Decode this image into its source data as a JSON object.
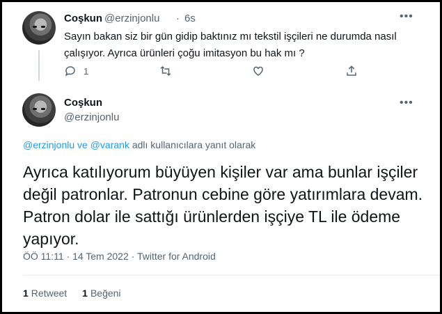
{
  "parent_tweet": {
    "name": "Coşkun",
    "handle": "@erzinjonlu",
    "separator": "·",
    "time": "6s",
    "text": "Sayın bakan siz bir gün gidip baktınız mı tekstil işçileri ne durumda nasıl çalışıyor. Ayrıca ürünleri çoğu imitasyon bu hak mı ?",
    "reply_count": "1",
    "icons": [
      "reply-icon",
      "retweet-icon",
      "like-icon",
      "share-icon",
      "more-icon"
    ]
  },
  "main_tweet": {
    "name": "Coşkun",
    "handle": "@erzinjonlu",
    "reply_to": {
      "mention1": "@erzinjonlu",
      "connector": " ve ",
      "mention2": "@varank",
      "suffix": " adlı kullanıcılara yanıt olarak"
    },
    "text": "Ayrıca katılıyorum büyüyen kişiler var ama bunlar işçiler değil patronlar. Patronun cebine göre yatırımlara devam. Patron dolar ile sattığı ürünlerden işçiye TL ile ödeme yapıyor.",
    "timestamp": "ÖÖ 11:11 · 14 Tem 2022 · Twitter for Android",
    "retweets": {
      "count": "1",
      "label": "Retweet"
    },
    "likes": {
      "count": "1",
      "label": "Beğeni"
    }
  },
  "colors": {
    "link": "#1d9bf0",
    "secondary_text": "#536471",
    "text": "#0f1419",
    "border": "#000000"
  }
}
